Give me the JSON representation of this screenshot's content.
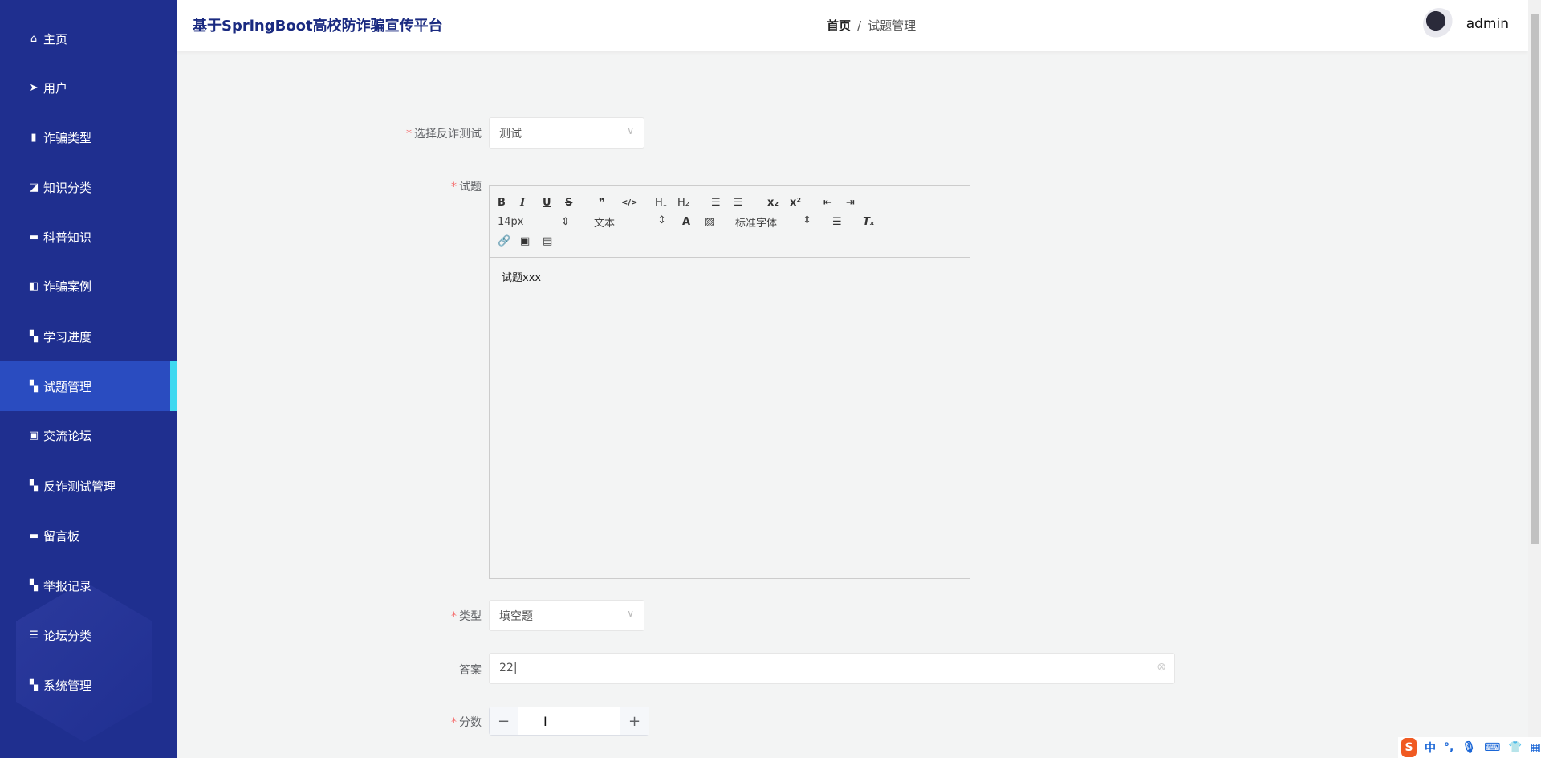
{
  "sidebar": {
    "items": [
      {
        "label": "主页",
        "icon": "home"
      },
      {
        "label": "用户",
        "icon": "paper-plane"
      },
      {
        "label": "诈骗类型",
        "icon": "clipboard"
      },
      {
        "label": "知识分类",
        "icon": "chart"
      },
      {
        "label": "科普知识",
        "icon": "ticket"
      },
      {
        "label": "诈骗案例",
        "icon": "wallet"
      },
      {
        "label": "学习进度",
        "icon": "grid"
      },
      {
        "label": "试题管理",
        "icon": "grid"
      },
      {
        "label": "交流论坛",
        "icon": "clipboard-check"
      },
      {
        "label": "反诈测试管理",
        "icon": "grid"
      },
      {
        "label": "留言板",
        "icon": "comment"
      },
      {
        "label": "举报记录",
        "icon": "grid"
      },
      {
        "label": "论坛分类",
        "icon": "list"
      },
      {
        "label": "系统管理",
        "icon": "grid"
      }
    ],
    "active_index": 7
  },
  "header": {
    "title": "基于SpringBoot高校防诈骗宣传平台",
    "breadcrumb": {
      "home": "首页",
      "sep": "/",
      "current": "试题管理"
    },
    "user": "admin"
  },
  "form": {
    "test": {
      "label": "选择反诈测试",
      "value": "测试"
    },
    "question": {
      "label": "试题",
      "content": "试题xxx",
      "toolbar": {
        "font_size": "14px",
        "header": "文本",
        "font": "标准字体"
      }
    },
    "type": {
      "label": "类型",
      "value": "填空题"
    },
    "answer": {
      "label": "答案",
      "value": "22"
    },
    "score": {
      "label": "分数",
      "value": ""
    }
  },
  "ime": {
    "lang": "中",
    "punct": "°,"
  },
  "colors": {
    "sidebar": "#1f2f8f",
    "active": "#2a4cc0",
    "accent": "#3fd8f0"
  }
}
